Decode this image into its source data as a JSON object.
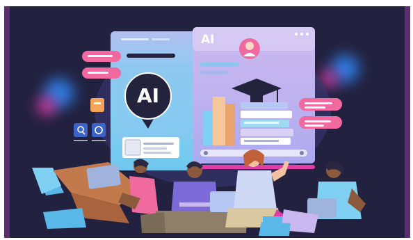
{
  "illustration": {
    "left_card_badge": "AI",
    "right_card_header": "AI"
  },
  "colors": {
    "background": "#22213f",
    "edge": "#5a2f6e",
    "card_blue": "#59b8e8",
    "card_lilac": "#c9b7ef",
    "bubble_pink": "#f06aa0",
    "glow_blue": "#2f7ee6",
    "glow_magenta": "#e13da6"
  }
}
